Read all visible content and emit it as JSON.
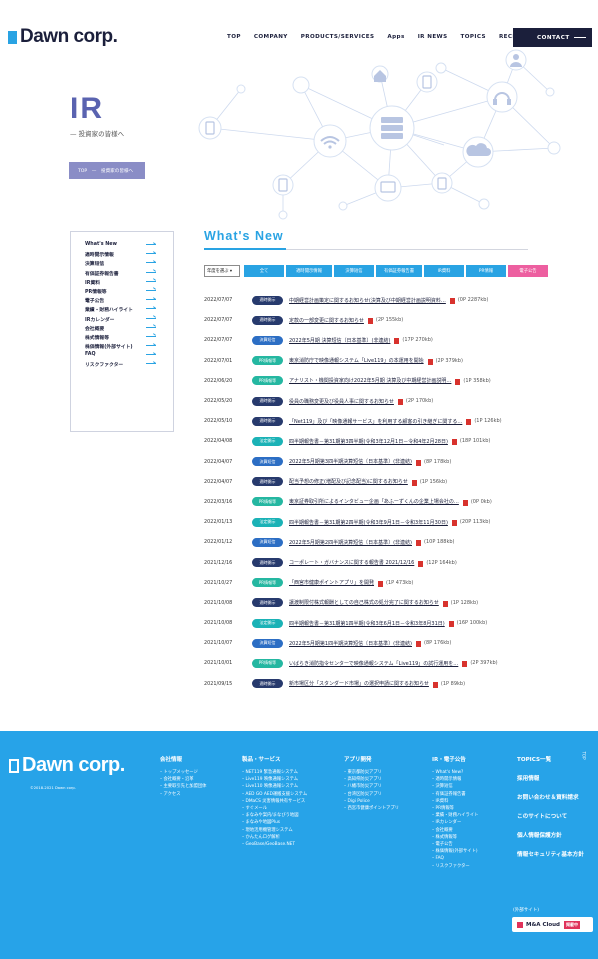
{
  "header": {
    "logo": "Dawn corp.",
    "nav": [
      "TOP",
      "COMPANY",
      "PRODUCTS/SERVICES",
      "Apps",
      "IR NEWS",
      "TOPICS",
      "RECRUIT"
    ],
    "contact": "CONTACT"
  },
  "hero": {
    "title": "IR",
    "subtitle": "— 投資家の皆様へ",
    "breadcrumb": "TOP　—　投資家の皆様へ"
  },
  "side_menu": [
    "What's New",
    "適時開示情報",
    "決算短信",
    "有価証券報告書",
    "IR資料",
    "PR情報等",
    "電子公告",
    "業績・財務ハイライト",
    "IRカレンダー",
    "会社概要",
    "株式情報等",
    "株価情報(外部サイト)",
    "FAQ",
    "リスクファクター"
  ],
  "whats_new": {
    "title": "What's New",
    "year_select": "年度を選ぶ ▾",
    "tabs": [
      "全て",
      "適時開示情報",
      "決算短信",
      "有価証券報告書",
      "IR資料",
      "PR情報",
      "電子公告"
    ],
    "rows": [
      {
        "date": "2022/07/07",
        "tag": "適時開示",
        "tag_color": "navy",
        "title": "中期経営計画策定に関するお知らせ(決算及び中期経営計画説明資料…",
        "size": "(0P 2287kb)"
      },
      {
        "date": "2022/07/07",
        "tag": "適時開示",
        "tag_color": "navy",
        "title": "定款の一部変更に関するお知らせ",
        "size": "(2P 155kb)"
      },
      {
        "date": "2022/07/07",
        "tag": "決算短信",
        "tag_color": "blue",
        "title": "2022年5月期 決算短信〔日本基準〕(非連結)",
        "size": "(17P 270kb)"
      },
      {
        "date": "2022/07/01",
        "tag": "PR情報等",
        "tag_color": "green",
        "title": "東京消防庁で映像通報システム「Live119」の本運用を開始",
        "size": "(2P 379kb)"
      },
      {
        "date": "2022/06/20",
        "tag": "PR情報等",
        "tag_color": "green",
        "title": "アナリスト・機関投資家向け2022年5月期 決算及び中期経営計画説明…",
        "size": "(1P 358kb)"
      },
      {
        "date": "2022/05/20",
        "tag": "適時開示",
        "tag_color": "navy",
        "title": "役員の職務変更及び役員人事に関するお知らせ",
        "size": "(2P 170kb)"
      },
      {
        "date": "2022/05/10",
        "tag": "適時開示",
        "tag_color": "navy",
        "title": "「Net119」及び「映像通報サービス」を利用する顧客の引き継ぎに関する…",
        "size": "(1P 126kb)"
      },
      {
        "date": "2022/04/08",
        "tag": "法定開示",
        "tag_color": "teal",
        "title": "四半期報告書－第31期第3四半期(令和3年12月1日－令和4年2月28日)",
        "size": "(18P 101kb)"
      },
      {
        "date": "2022/04/07",
        "tag": "決算短信",
        "tag_color": "blue",
        "title": "2022年5月期第3四半期決算短信〔日本基準〕(非連結)",
        "size": "(8P 178kb)"
      },
      {
        "date": "2022/04/07",
        "tag": "適時開示",
        "tag_color": "navy",
        "title": "配当予想の修正(増配及び記念配当)に関するお知らせ",
        "size": "(1P 156kb)"
      },
      {
        "date": "2022/03/16",
        "tag": "PR情報等",
        "tag_color": "green",
        "title": "東京証券取引所によるインタビュー企画「あふーずくんの企業上場会社の…",
        "size": "(0P 0kb)"
      },
      {
        "date": "2022/01/13",
        "tag": "法定開示",
        "tag_color": "teal",
        "title": "四半期報告書－第31期第2四半期(令和3年9月1日－令和3年11月30日)",
        "size": "(20P 113kb)"
      },
      {
        "date": "2022/01/12",
        "tag": "決算短信",
        "tag_color": "blue",
        "title": "2022年5月期第2四半期決算短信〔日本基準〕(非連結)",
        "size": "(10P 188kb)"
      },
      {
        "date": "2021/12/16",
        "tag": "適時開示",
        "tag_color": "navy",
        "title": "コーポレート・ガバナンスに関する報告書 2021/12/16",
        "size": "(12P 164kb)"
      },
      {
        "date": "2021/10/27",
        "tag": "PR情報等",
        "tag_color": "green",
        "title": "「西宮市健康ポイントアプリ」を開発",
        "size": "(1P 473kb)"
      },
      {
        "date": "2021/10/08",
        "tag": "適時開示",
        "tag_color": "navy",
        "title": "譲渡制限付株式報酬としての自己株式の処分完了に関するお知らせ",
        "size": "(1P 128kb)"
      },
      {
        "date": "2021/10/08",
        "tag": "法定開示",
        "tag_color": "teal",
        "title": "四半期報告書－第31期第1四半期(令和3年6月1日－令和3年8月31日)",
        "size": "(16P 100kb)"
      },
      {
        "date": "2021/10/07",
        "tag": "決算短信",
        "tag_color": "blue",
        "title": "2022年5月期第1四半期決算短信〔日本基準〕(非連結)",
        "size": "(8P 176kb)"
      },
      {
        "date": "2021/10/01",
        "tag": "PR情報等",
        "tag_color": "green",
        "title": "いばらき消防指令センターで映像通報システム「Live119」の試行運用を…",
        "size": "(2P 397kb)"
      },
      {
        "date": "2021/09/15",
        "tag": "適時開示",
        "tag_color": "navy",
        "title": "新市場区分「スタンダード市場」の選択申請に関するお知らせ",
        "size": "(1P 89kb)"
      }
    ]
  },
  "footer": {
    "logo": "Dawn corp.",
    "copyright": "©2018-2021 Dawn corp.",
    "columns": [
      {
        "title": "会社情報",
        "items": [
          "トップメッセージ",
          "会社概要・沿革",
          "主要取引先と加盟団体",
          "アクセス"
        ]
      },
      {
        "title": "製品・サービス",
        "items": [
          "NET119 緊急通報システム",
          "Live119 映像通報システム",
          "Live110 映像通報システム",
          "AED GO AED運搬支援システム",
          "DMaCS 災害情報共有サービス",
          "すぐメール",
          "まなみや案内/まなびう地図",
          "まなみや地図Plus",
          "現地活用機管理システム",
          "かんたんログ解析",
          "GeoBase/GeoBase.NET"
        ]
      },
      {
        "title": "アプリ開発",
        "items": [
          "東京都防災アプリ",
          "高知県防災アプリ",
          "八幡市防災アプリ",
          "台湾区防災アプリ",
          "Digi Police",
          "西宮市健康ポイントアプリ"
        ]
      },
      {
        "title": "IR・電子公告",
        "items": [
          "What's New?",
          "適時開示情報",
          "決算短信",
          "有価証券報告書",
          "IR資料",
          "PR情報等",
          "業績・財務ハイライト",
          "IRカレンダー",
          "会社概要",
          "株式情報等",
          "電子公告",
          "株価情報(外部サイト)",
          "FAQ",
          "リスクファクター"
        ]
      }
    ],
    "right_links": [
      "TOPICS一覧",
      "採用情報",
      "お問い合わせ＆資料請求",
      "このサイトについて",
      "個人情報保護方針",
      "情報セキュリティ基本方針"
    ],
    "pagetop": "TOP",
    "external_label": "(外部サイト)",
    "mna_label": "M&A Cloud",
    "mna_badge": "掲載中"
  }
}
